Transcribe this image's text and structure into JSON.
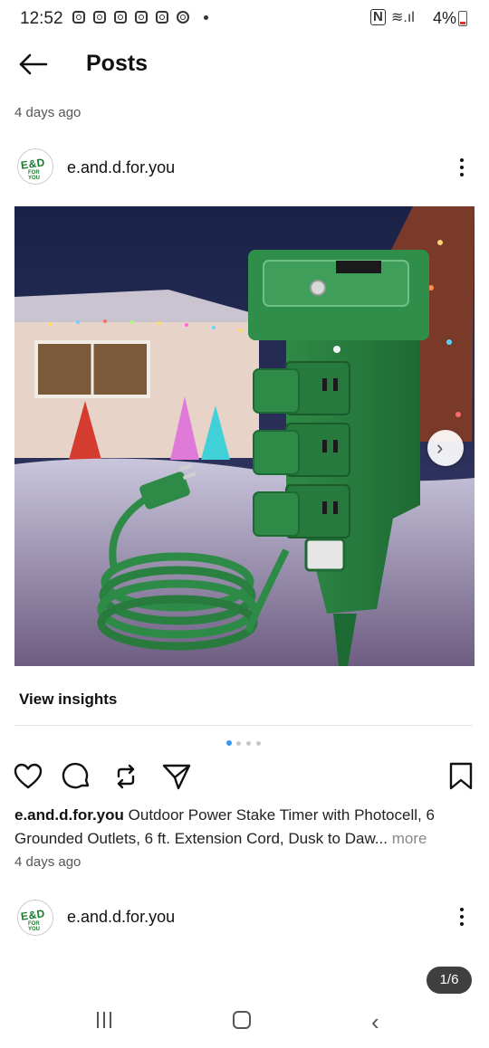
{
  "status_bar": {
    "time": "12:52",
    "notification_icons": [
      "instagram-icon",
      "instagram-icon",
      "instagram-icon",
      "instagram-icon",
      "instagram-icon",
      "threads-icon"
    ],
    "battery": "4%",
    "system_icons": [
      "nfc-icon",
      "wifi-icon",
      "signal-icon",
      "battery-icon"
    ]
  },
  "header": {
    "title": "Posts",
    "back_icon": "arrow-left-icon"
  },
  "top_post_meta": {
    "time_ago": "4 days ago"
  },
  "post": {
    "username": "e.and.d.for.you",
    "avatar_text": "E&D",
    "avatar_subtext": "FOR YOU",
    "image_description_icon": "product-photo",
    "view_insights": "View insights",
    "caption_text": "Outdoor Power Stake Timer with Photocell, 6 Grounded Outlets, 6 ft. Extension Cord, Dusk to Daw...",
    "caption_more": " more",
    "time_ago": "4 days ago",
    "carousel_index": 1,
    "carousel_total": 4,
    "action_icons": [
      "heart-icon",
      "comment-icon",
      "repost-icon",
      "share-icon",
      "bookmark-icon"
    ]
  },
  "next_post": {
    "username": "e.and.d.for.you",
    "avatar_text": "E&D",
    "avatar_subtext": "FOR YOU",
    "page_counter": "1/6"
  },
  "colors": {
    "accent": "#3897f0",
    "product_green": "#2e8b47",
    "sky": "#1f2a55"
  }
}
